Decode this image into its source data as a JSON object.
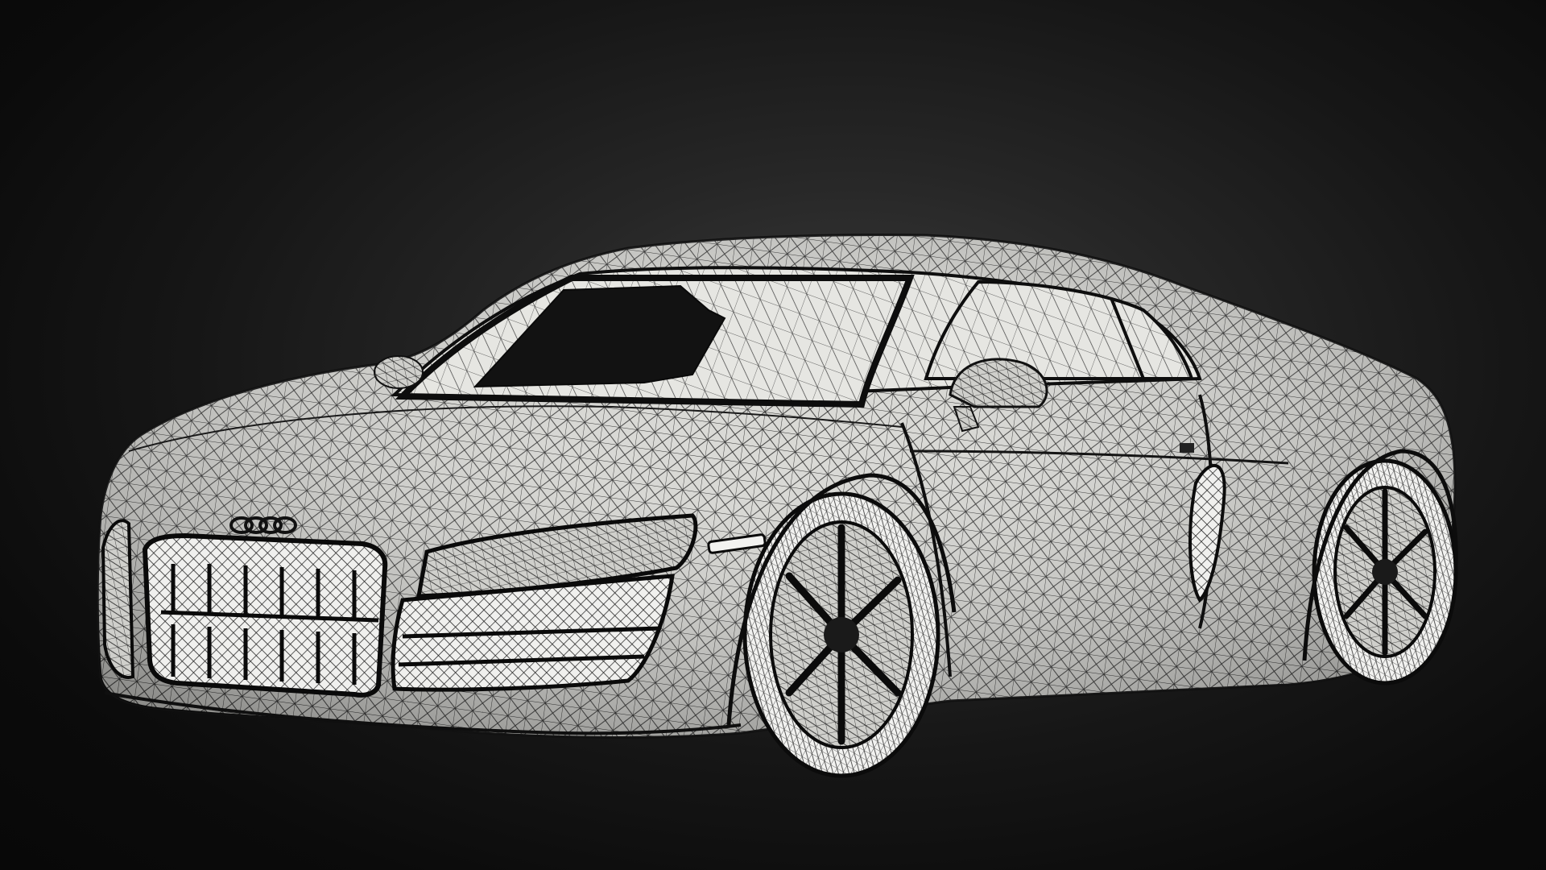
{
  "scene": {
    "subject": "wireframe-sports-car",
    "background_color": "#0b0b0b",
    "body_color": "#dcdcd8",
    "wire_color": "#1a1a1a",
    "glass_color": "#111111",
    "icons": [
      "car-logo-rings-icon"
    ]
  }
}
